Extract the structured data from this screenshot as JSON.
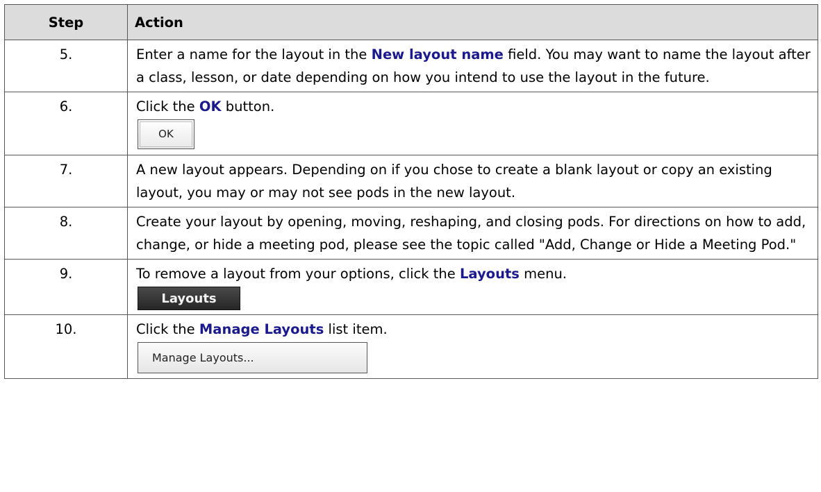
{
  "header": {
    "step": "Step",
    "action": "Action"
  },
  "rows": [
    {
      "num": "5.",
      "pre": "Enter a name for the layout in the ",
      "hl": "New layout name",
      "post": " field.  You may want to name the layout after a class, lesson, or date depending on how you intend to use the layout in the future."
    },
    {
      "num": "6.",
      "pre": "Click the ",
      "hl": "OK",
      "post": " button.",
      "button": "OK"
    },
    {
      "num": "7.",
      "text": "A new layout appears.  Depending on if you chose to create a blank layout or copy an existing layout, you may or may not see pods in the new layout."
    },
    {
      "num": "8.",
      "text": "Create your layout by opening, moving, reshaping, and closing pods.  For directions on how to add, change, or hide a meeting pod, please see the topic called \"Add, Change or Hide a Meeting Pod.\""
    },
    {
      "num": "9.",
      "pre": "To remove a layout from your options, click the ",
      "hl": "Layouts",
      "post": " menu.",
      "button": "Layouts"
    },
    {
      "num": "10.",
      "pre": "Click the ",
      "hl": "Manage Layouts",
      "post": " list item.",
      "button": "Manage Layouts..."
    }
  ],
  "colors": {
    "highlight": "#1a1a8c",
    "header_bg": "#dcdcdc",
    "border": "#555555"
  }
}
